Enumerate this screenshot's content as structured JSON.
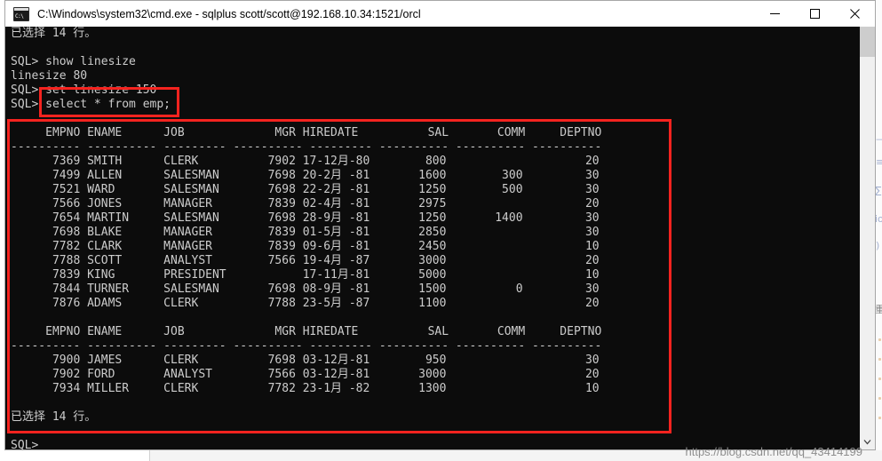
{
  "window": {
    "title": "C:\\Windows\\system32\\cmd.exe - sqlplus  scott/scott@192.168.10.34:1521/orcl",
    "icon_label": "C:\\",
    "minimize_label": "—",
    "maximize_label": "□",
    "close_label": "✕"
  },
  "scrollbar": {
    "up_arrow": "scroll-up",
    "down_arrow": "scroll-down"
  },
  "terminal": {
    "lines": [
      "已选择 14 行。",
      "",
      "SQL> show linesize",
      "linesize 80",
      "SQL> set linesize 150",
      "SQL> select * from emp;",
      "",
      "     EMPNO ENAME      JOB             MGR HIREDATE          SAL       COMM     DEPTNO",
      "---------- ---------- --------- ---------- --------- ---------- ---------- ----------",
      "      7369 SMITH      CLERK          7902 17-12月-80        800                    20",
      "      7499 ALLEN      SALESMAN       7698 20-2月 -81       1600        300         30",
      "      7521 WARD       SALESMAN       7698 22-2月 -81       1250        500         30",
      "      7566 JONES      MANAGER        7839 02-4月 -81       2975                    20",
      "      7654 MARTIN     SALESMAN       7698 28-9月 -81       1250       1400         30",
      "      7698 BLAKE      MANAGER        7839 01-5月 -81       2850                    30",
      "      7782 CLARK      MANAGER        7839 09-6月 -81       2450                    10",
      "      7788 SCOTT      ANALYST        7566 19-4月 -87       3000                    20",
      "      7839 KING       PRESIDENT           17-11月-81       5000                    10",
      "      7844 TURNER     SALESMAN       7698 08-9月 -81       1500          0         30",
      "      7876 ADAMS      CLERK          7788 23-5月 -87       1100                    20",
      "",
      "     EMPNO ENAME      JOB             MGR HIREDATE          SAL       COMM     DEPTNO",
      "---------- ---------- --------- ---------- --------- ---------- ---------- ----------",
      "      7900 JAMES      CLERK          7698 03-12月-81        950                    30",
      "      7902 FORD       ANALYST        7566 03-12月-81       3000                    20",
      "      7934 MILLER     CLERK          7782 23-1月 -82       1300                    10",
      "",
      "已选择 14 行。",
      "",
      "SQL>"
    ]
  },
  "table_data": {
    "type": "table",
    "columns": [
      "EMPNO",
      "ENAME",
      "JOB",
      "MGR",
      "HIREDATE",
      "SAL",
      "COMM",
      "DEPTNO"
    ],
    "rows": [
      [
        "7369",
        "SMITH",
        "CLERK",
        "7902",
        "17-12月-80",
        "800",
        "",
        "20"
      ],
      [
        "7499",
        "ALLEN",
        "SALESMAN",
        "7698",
        "20-2月 -81",
        "1600",
        "300",
        "30"
      ],
      [
        "7521",
        "WARD",
        "SALESMAN",
        "7698",
        "22-2月 -81",
        "1250",
        "500",
        "30"
      ],
      [
        "7566",
        "JONES",
        "MANAGER",
        "7839",
        "02-4月 -81",
        "2975",
        "",
        "20"
      ],
      [
        "7654",
        "MARTIN",
        "SALESMAN",
        "7698",
        "28-9月 -81",
        "1250",
        "1400",
        "30"
      ],
      [
        "7698",
        "BLAKE",
        "MANAGER",
        "7839",
        "01-5月 -81",
        "2850",
        "",
        "30"
      ],
      [
        "7782",
        "CLARK",
        "MANAGER",
        "7839",
        "09-6月 -81",
        "2450",
        "",
        "10"
      ],
      [
        "7788",
        "SCOTT",
        "ANALYST",
        "7566",
        "19-4月 -87",
        "3000",
        "",
        "20"
      ],
      [
        "7839",
        "KING",
        "PRESIDENT",
        "",
        "17-11月-81",
        "5000",
        "",
        "10"
      ],
      [
        "7844",
        "TURNER",
        "SALESMAN",
        "7698",
        "08-9月 -81",
        "1500",
        "0",
        "30"
      ],
      [
        "7876",
        "ADAMS",
        "CLERK",
        "7788",
        "23-5月 -87",
        "1100",
        "",
        "20"
      ],
      [
        "7900",
        "JAMES",
        "CLERK",
        "7698",
        "03-12月-81",
        "950",
        "",
        "30"
      ],
      [
        "7902",
        "FORD",
        "ANALYST",
        "7566",
        "03-12月-81",
        "3000",
        "",
        "20"
      ],
      [
        "7934",
        "MILLER",
        "CLERK",
        "7782",
        "23-1月 -82",
        "1300",
        "",
        "10"
      ]
    ],
    "row_count_message": "已选择 14 行。"
  },
  "annotations": {
    "command_box_note": "set linesize 150 / select * from emp;",
    "result_box_note": "query result block",
    "color": "#f5231f"
  },
  "watermark": {
    "text": "https://blog.csdn.net/qq_43414199"
  }
}
